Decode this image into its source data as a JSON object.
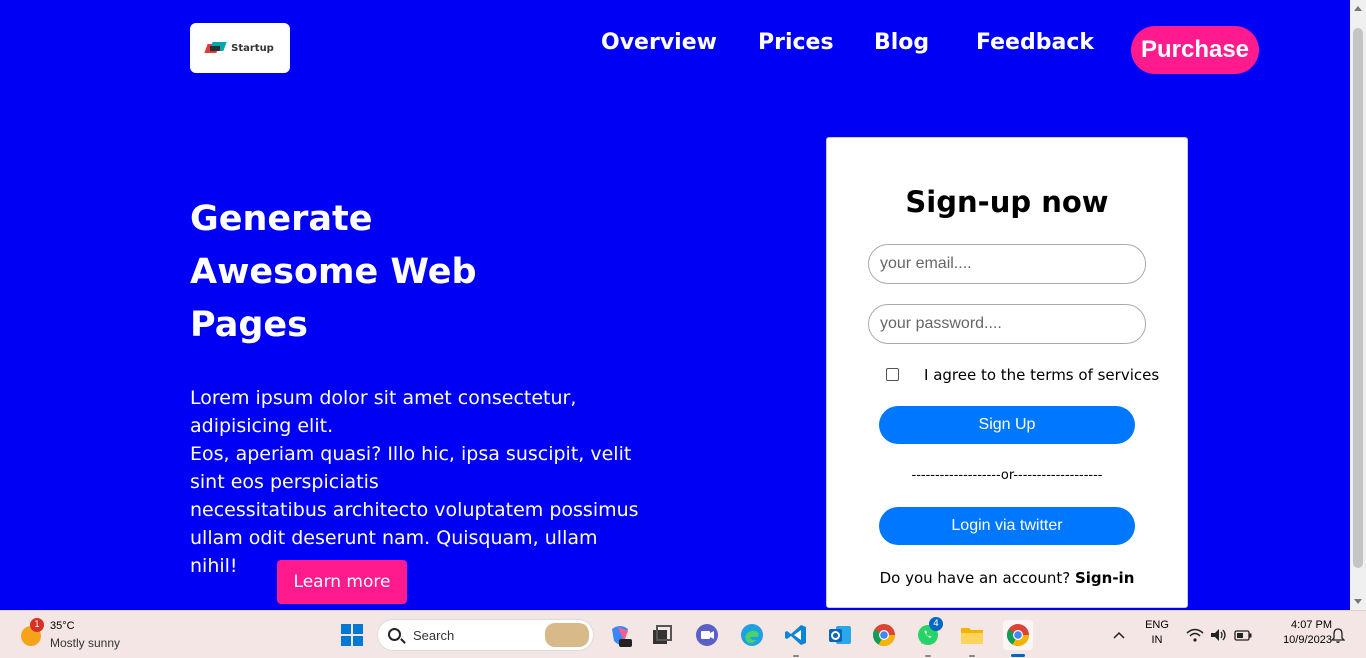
{
  "header": {
    "logo_text": "Startup",
    "nav": [
      "Overview",
      "Prices",
      "Blog",
      "Feedback"
    ],
    "purchase_label": "Purchase"
  },
  "hero": {
    "title_lines": [
      "Generate",
      "Awesome Web",
      "Pages"
    ],
    "body_lines": [
      "Lorem ipsum dolor sit amet consectetur,",
      "adipisicing elit.",
      "Eos, aperiam quasi? Illo hic, ipsa suscipit, velit",
      "sint eos perspiciatis",
      "necessitatibus architecto voluptatem possimus",
      "ullam odit deserunt nam. Quisquam, ullam nihil!"
    ],
    "learn_more_label": "Learn more"
  },
  "signup": {
    "title": "Sign-up now",
    "email_placeholder": "your email....",
    "password_placeholder": "your password....",
    "terms_label": "I agree to the terms of services",
    "signup_label": "Sign Up",
    "or_divider": "-------------------or-------------------",
    "twitter_label": "Login via twitter",
    "account_prompt": "Do you have an account?",
    "signin_label": "Sign-in"
  },
  "taskbar": {
    "weather_badge": "1",
    "weather_temp": "35°C",
    "weather_condition": "Mostly sunny",
    "search_label": "Search",
    "whatsapp_badge": "4",
    "lang_top": "ENG",
    "lang_bottom": "IN",
    "time": "4:07 PM",
    "date": "10/9/2023",
    "icons": [
      "windows-start-icon",
      "copilot-icon",
      "task-view-icon",
      "teams-icon",
      "edge-icon",
      "vscode-icon",
      "outlook-icon",
      "chrome-icon",
      "whatsapp-icon",
      "file-explorer-icon",
      "chrome-active-icon"
    ],
    "colors": {
      "page_bg": "#0000f5",
      "accent_pink": "#ff1b8d",
      "button_blue": "#0077ff"
    }
  }
}
